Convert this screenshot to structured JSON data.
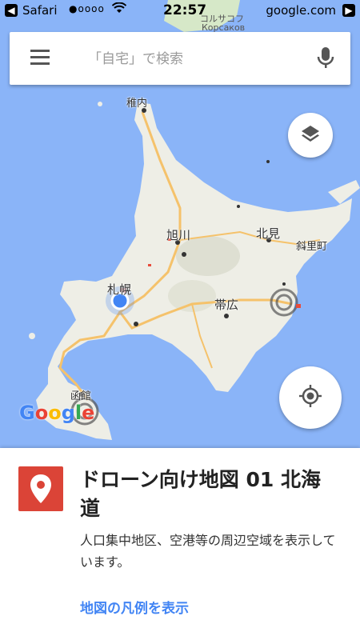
{
  "status_bar": {
    "carrier": "Safari",
    "signal": "●oooo",
    "time": "22:57",
    "url": "google.com"
  },
  "search": {
    "placeholder": "「自宅」で検索"
  },
  "map": {
    "labels": {
      "wakkanai": "稚内",
      "asahikawa": "旭川",
      "kitami": "北見",
      "shari": "斜里町",
      "sapporo": "札幌",
      "obihiro": "帯広",
      "hakodate": "函館",
      "korsakov_jp": "コルサコフ",
      "korsakov_ru": "Корсаков"
    },
    "water_color": "#8ab4f8",
    "land_color": "#eeeee6",
    "road_color": "#f5c26b"
  },
  "google_logo": {
    "g1": "G",
    "o1": "o",
    "o2": "o",
    "g2": "g",
    "l": "l",
    "e": "e"
  },
  "sheet": {
    "title": "ドローン向け地図 01 北海道",
    "description": "人口集中地区、空港等の周辺空域を表示しています。",
    "legend_link": "地図の凡例を表示"
  },
  "icons": {
    "menu": "hamburger-menu-icon",
    "mic": "microphone-icon",
    "layers": "layers-icon",
    "locate": "my-location-icon",
    "pin": "map-pin-icon"
  }
}
